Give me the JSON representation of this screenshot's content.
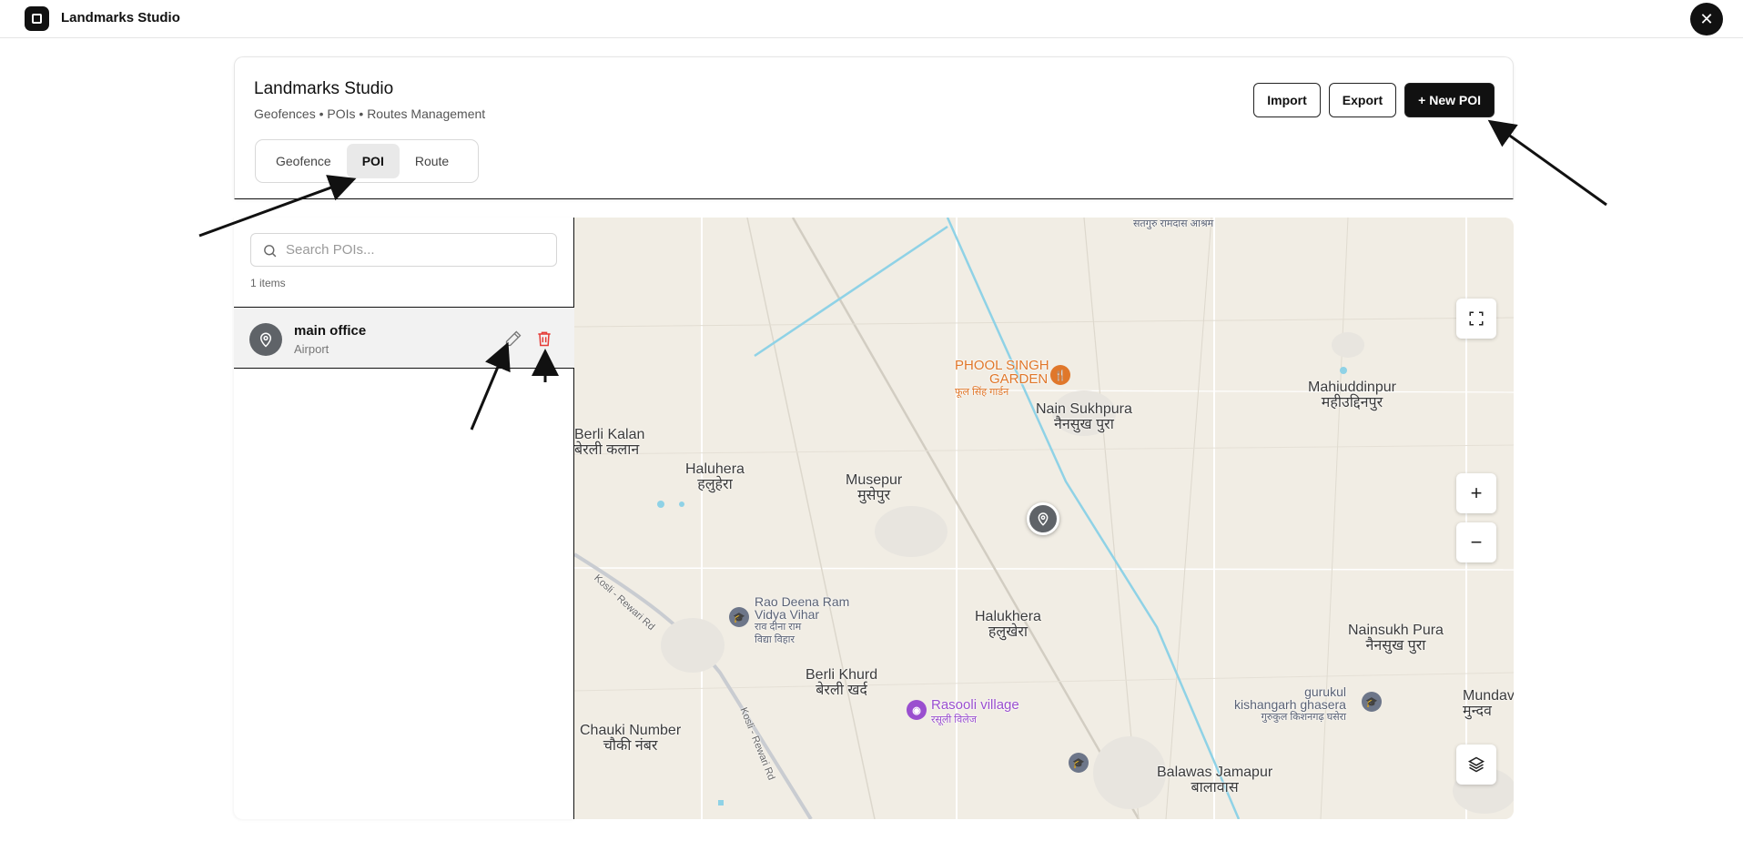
{
  "app": {
    "title": "Landmarks Studio",
    "close_label": "✕"
  },
  "header": {
    "title": "Landmarks Studio",
    "subtitle": "Geofences • POIs • Routes Management",
    "tabs": [
      {
        "label": "Geofence",
        "active": false
      },
      {
        "label": "POI",
        "active": true
      },
      {
        "label": "Route",
        "active": false
      }
    ],
    "actions": {
      "import_label": "Import",
      "export_label": "Export",
      "new_label": "+ New POI"
    }
  },
  "sidebar": {
    "search_placeholder": "Search POIs...",
    "search_value": "",
    "count_text": "1 items",
    "items": [
      {
        "name": "main office",
        "type": "Airport",
        "icon": "map-pin-icon"
      }
    ]
  },
  "map": {
    "labels": [
      {
        "en": "Berli Kalan",
        "hi": "बेरली कलान"
      },
      {
        "en": "Haluhera",
        "hi": "हलुहेरा"
      },
      {
        "en": "Musepur",
        "hi": "मुसेपुर"
      },
      {
        "en": "Nain Sukhpura",
        "hi": "नैनसुख पुरा"
      },
      {
        "en": "Mahiuddinpur",
        "hi": "महीउद्दिनपुर"
      },
      {
        "en": "Halukhera",
        "hi": "हलुखेरा"
      },
      {
        "en": "Nainsukh Pura",
        "hi": "नैनसुख पुरा"
      },
      {
        "en": "Berli Khurd",
        "hi": "बेरली खर्द"
      },
      {
        "en": "Chauki Number",
        "hi": "चौकी नंबर"
      },
      {
        "en": "Balawas Jamapur",
        "hi": "बालावास"
      },
      {
        "en": "Mundav",
        "hi": "मुन्दव"
      }
    ],
    "pois": {
      "phool_singh": {
        "en": "PHOOL SINGH GARDEN",
        "line1": "PHOOL SINGH",
        "line2": "GARDEN",
        "hi": "फूल सिंह गार्डन"
      },
      "rasooli": {
        "en": "Rasooli village",
        "hi": "रसूली विलेज"
      },
      "rao_deena": {
        "line1": "Rao Deena Ram",
        "line2": "Vidya Vihar",
        "hi1": "राव दीना राम",
        "hi2": "विद्या विहार"
      },
      "gurukul": {
        "line1": "gurukul",
        "line2": "kishangarh ghasera",
        "hi": "गुरुकुल किशनगढ़ घसेरा"
      },
      "ashram": {
        "hi": "सतगुरु रामदास आश्रम"
      }
    },
    "roads": [
      "Kosli - Rewari Rd",
      "Kosli - Rewari Rd"
    ],
    "controls": {
      "zoom_in": "+",
      "zoom_out": "−"
    },
    "colors": {
      "land": "#f1ede4",
      "canal": "#8fd2e6",
      "road": "#ffffff",
      "marker": "#5f6368",
      "poi_orange": "#e0772a",
      "poi_purple": "#9a4fcf"
    }
  }
}
